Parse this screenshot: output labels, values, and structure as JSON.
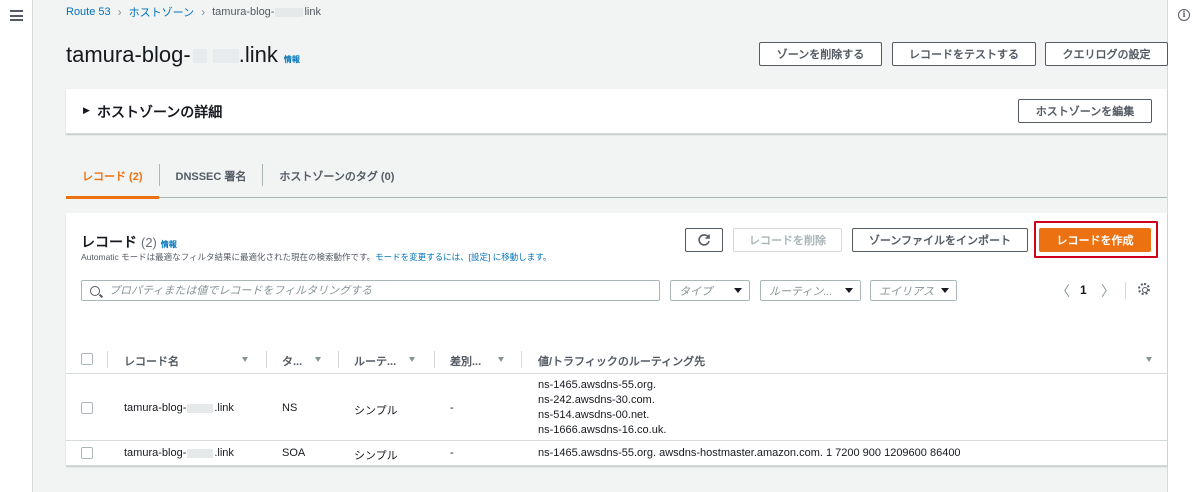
{
  "breadcrumb": {
    "items": [
      "Route 53",
      "ホストゾーン"
    ],
    "current_prefix": "tamura-blog-",
    "current_suffix": "link"
  },
  "title": {
    "prefix": "tamura-blog-",
    "suffix": ".link",
    "info": "情報"
  },
  "header_buttons": {
    "delete_zone": "ゾーンを削除する",
    "test_record": "レコードをテストする",
    "query_log": "クエリログの設定"
  },
  "details": {
    "title": "ホストゾーンの詳細",
    "edit_button": "ホストゾーンを編集"
  },
  "tabs": [
    {
      "label": "レコード (2)"
    },
    {
      "label": "DNSSEC 署名"
    },
    {
      "label": "ホストゾーンのタグ (0)"
    }
  ],
  "records": {
    "title": "レコード",
    "count": "(2)",
    "info": "情報",
    "description": "Automatic モードは最適なフィルタ結果に最適化された現在の検索動作です。",
    "description_link": "モードを変更するには、[設定] に移動します。",
    "refresh_icon": "refresh-icon",
    "delete_button": "レコードを削除",
    "import_button": "ゾーンファイルをインポート",
    "create_button": "レコードを作成",
    "search_placeholder": "プロパティまたは値でレコードをフィルタリングする",
    "filters": {
      "type": "タイプ",
      "routing": "ルーティン...",
      "alias": "エイリアス"
    },
    "pagination": {
      "page": "1",
      "prev": "〈",
      "next": "〉"
    },
    "columns": {
      "name": "レコード名",
      "type": "タ...",
      "routing": "ルーテ...",
      "diff": "差別...",
      "value": "値/トラフィックのルーティング先"
    },
    "rows": [
      {
        "name_prefix": "tamura-blog-",
        "name_suffix": ".link",
        "type": "NS",
        "routing": "シンプル",
        "diff": "-",
        "values": [
          "ns-1465.awsdns-55.org.",
          "ns-242.awsdns-30.com.",
          "ns-514.awsdns-00.net.",
          "ns-1666.awsdns-16.co.uk."
        ]
      },
      {
        "name_prefix": "tamura-blog-",
        "name_suffix": ".link",
        "type": "SOA",
        "routing": "シンプル",
        "diff": "-",
        "values": [
          "ns-1465.awsdns-55.org. awsdns-hostmaster.amazon.com. 1 7200 900 1209600 86400"
        ]
      }
    ]
  },
  "colors": {
    "primary": "#ec7211",
    "link": "#0073bb",
    "highlight": "#d0021b"
  }
}
